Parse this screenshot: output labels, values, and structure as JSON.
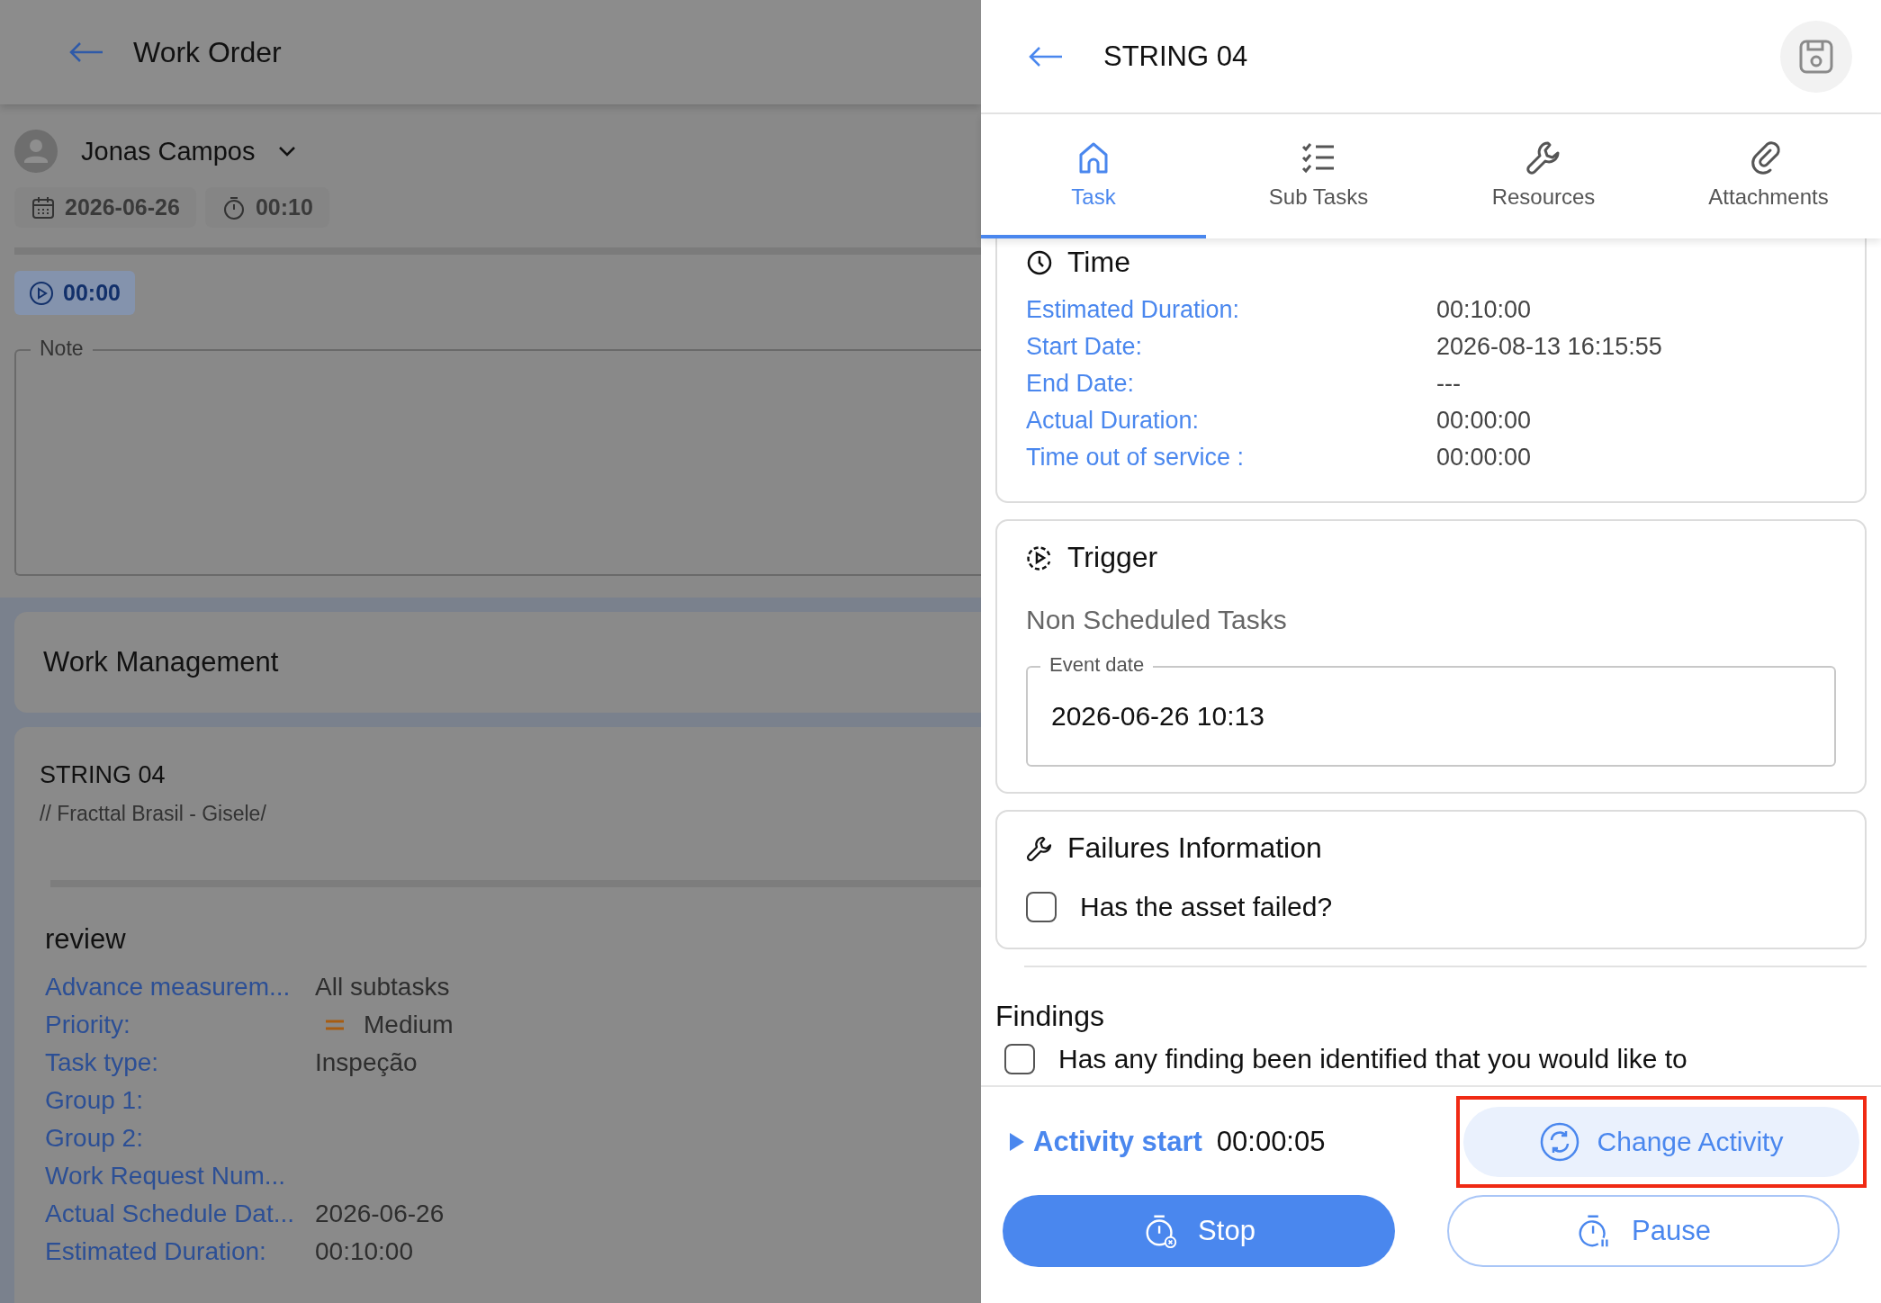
{
  "background_page": {
    "header": {
      "title": "Work Order"
    },
    "assignee": {
      "name": "Jonas Campos"
    },
    "chips": [
      {
        "kind": "date",
        "text": "2026-06-26"
      },
      {
        "kind": "duration",
        "text": "00:10"
      }
    ],
    "timer": "00:00",
    "note": {
      "label": "Note"
    },
    "work_management": {
      "title": "Work Management"
    },
    "task_card": {
      "title": "STRING 04",
      "path": "// Fracttal Brasil - Gisele/",
      "section": "review",
      "fields": [
        {
          "kind": "text",
          "label": "Advance measurem...",
          "value": "All subtasks"
        },
        {
          "kind": "priority",
          "label": "Priority:",
          "value": "Medium"
        },
        {
          "kind": "text",
          "label": "Task type:",
          "value": "Inspeção"
        },
        {
          "kind": "text",
          "label": "Group 1:"
        },
        {
          "kind": "text",
          "label": "Group 2:"
        },
        {
          "kind": "text",
          "label": "Work Request Num..."
        },
        {
          "kind": "text",
          "label": "Actual Schedule Dat...",
          "value": "2026-06-26"
        },
        {
          "kind": "text",
          "label": "Estimated Duration:",
          "value": "00:10:00"
        }
      ]
    }
  },
  "panel": {
    "title": "STRING 04",
    "tabs": [
      {
        "kind": "home",
        "label": "Task",
        "selected": true
      },
      {
        "kind": "checklist",
        "label": "Sub Tasks",
        "selected": false
      },
      {
        "kind": "wrench",
        "label": "Resources",
        "selected": false
      },
      {
        "kind": "paperclip",
        "label": "Attachments",
        "selected": false
      }
    ],
    "time": {
      "title": "Time",
      "rows": [
        {
          "label": "Estimated Duration:",
          "value": "00:10:00"
        },
        {
          "label": "Start Date:",
          "value": "2026-08-13 16:15:55"
        },
        {
          "label": "End Date:",
          "value": "---"
        },
        {
          "label": "Actual Duration:",
          "value": "00:00:00"
        },
        {
          "label": "Time out of service :",
          "value": "00:00:00"
        }
      ]
    },
    "trigger": {
      "title": "Trigger",
      "type": "Non Scheduled Tasks",
      "event_date": {
        "label": "Event date",
        "value": "2026-06-26 10:13"
      }
    },
    "failures": {
      "title": "Failures Information",
      "question": "Has the asset failed?",
      "checked": false
    },
    "findings": {
      "title": "Findings",
      "question": "Has any finding been identified that you would like to",
      "checked": false
    },
    "footer": {
      "activity_label": "Activity start",
      "elapsed": "00:00:05",
      "change_button": {
        "label": "Change Activity",
        "highlighted": true
      },
      "stop_button": {
        "label": "Stop"
      },
      "pause_button": {
        "label": "Pause"
      }
    }
  }
}
